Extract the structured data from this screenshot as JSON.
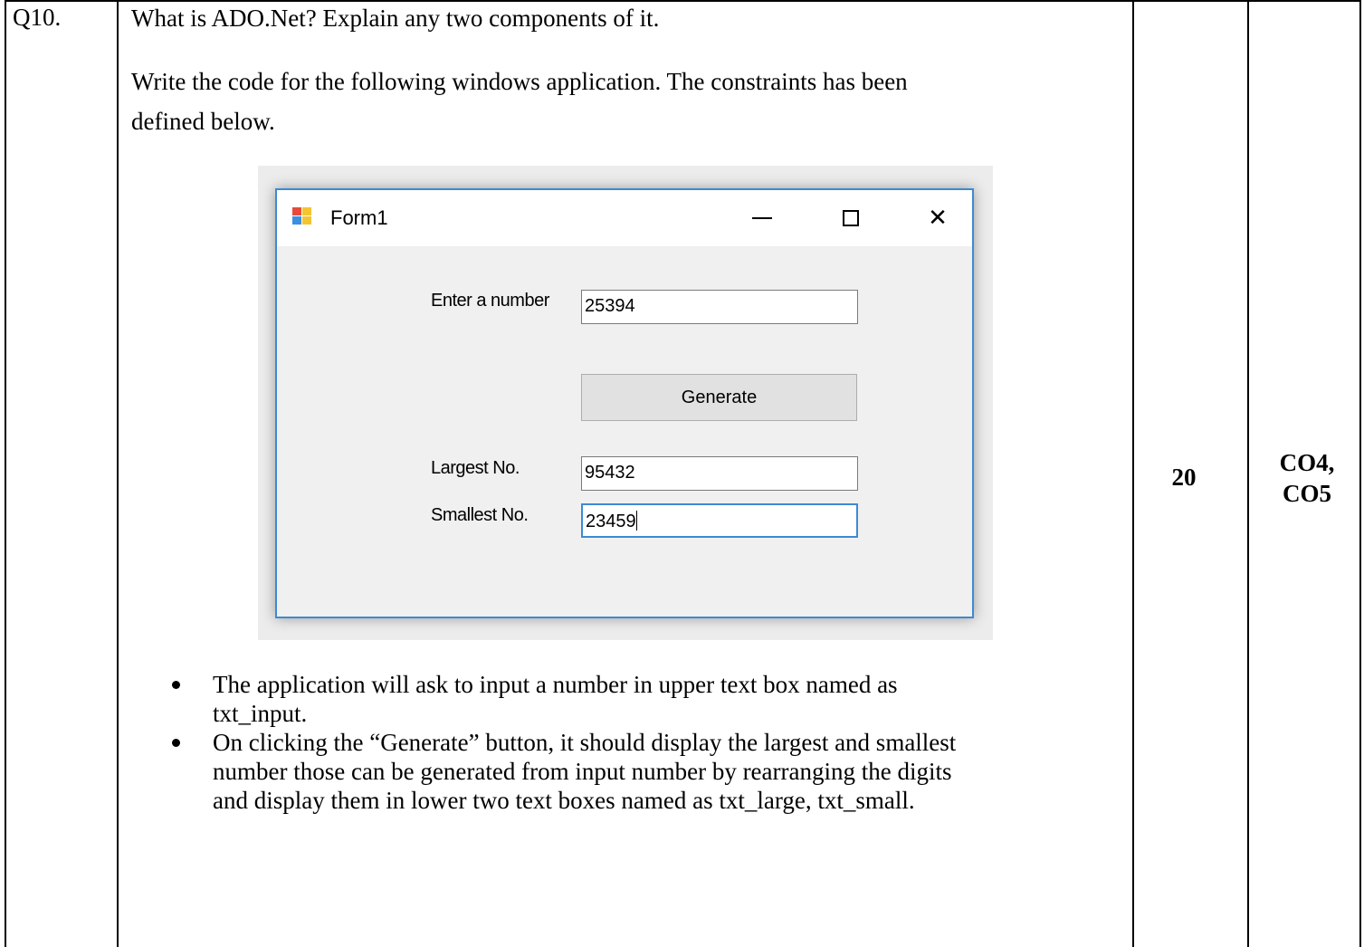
{
  "question": {
    "number": "Q10.",
    "line1": "What is ADO.Net? Explain any two components of it.",
    "line2": "Write the code for the following windows application. The constraints has been",
    "line3": "defined below.",
    "marks": "20",
    "co_line1": "CO4,",
    "co_line2": "CO5"
  },
  "form": {
    "title": "Form1",
    "icons": {
      "app": "winforms-app-icon",
      "minimize": "minimize-icon",
      "maximize": "maximize-icon",
      "close": "close-icon"
    },
    "close_glyph": "✕",
    "enter_label": "Enter a number",
    "input_value": "25394",
    "generate_label": "Generate",
    "largest_label": "Largest No.",
    "largest_value": "95432",
    "smallest_label": "Smallest No.",
    "smallest_value": "23459"
  },
  "bullets": [
    {
      "line1": "The application will ask to input a number in upper text box named as",
      "line2": "txt_input."
    },
    {
      "line1": "On clicking the “Generate” button, it should display the largest and smallest",
      "line2": "number those can be generated from input number by rearranging the digits",
      "line3": "and display them in lower two text boxes named as txt_large, txt_small."
    }
  ],
  "colors": {
    "accent": "#3c8ad6",
    "form_bg": "#f0f0f0",
    "button_bg": "#e1e1e1"
  }
}
